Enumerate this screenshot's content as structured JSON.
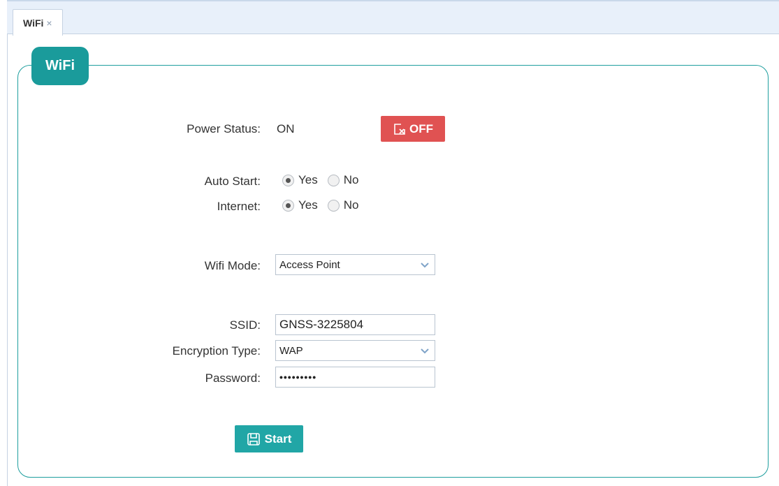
{
  "tabs": [
    {
      "label": "WiFi",
      "close": "×"
    }
  ],
  "panel": {
    "title": "WiFi"
  },
  "power_status": {
    "label": "Power Status:",
    "value": "ON",
    "button_label": "OFF"
  },
  "auto_start": {
    "label": "Auto Start:",
    "options": [
      "Yes",
      "No"
    ],
    "selected": "Yes"
  },
  "internet": {
    "label": "Internet:",
    "options": [
      "Yes",
      "No"
    ],
    "selected": "Yes"
  },
  "wifi_mode": {
    "label": "Wifi Mode:",
    "value": "Access Point"
  },
  "ssid": {
    "label": "SSID:",
    "value": "GNSS-3225804"
  },
  "encryption_type": {
    "label": "Encryption Type:",
    "value": "WAP"
  },
  "password": {
    "label": "Password:",
    "value": "•••••••••"
  },
  "start_button": {
    "label": "Start"
  },
  "colors": {
    "accent": "#1a9b9b",
    "danger": "#e05252",
    "tab_bg": "#e8f0fa"
  }
}
